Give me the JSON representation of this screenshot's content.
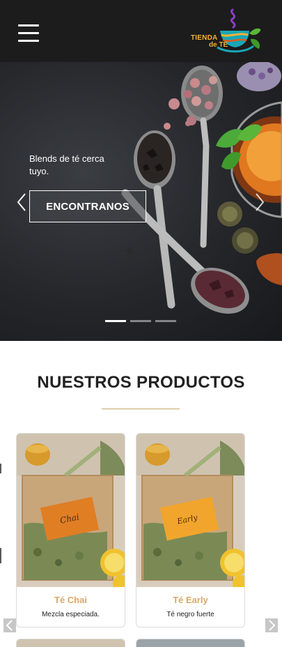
{
  "header": {
    "menu_icon": "hamburger-icon",
    "logo": {
      "line1": "TIENDA",
      "line2": "de TE"
    }
  },
  "hero": {
    "caption": "Blends de té cerca tuyo.",
    "button_label": "ENCONTRANOS",
    "prev_icon": "chevron-left-icon",
    "next_icon": "chevron-right-icon",
    "slides_count": 3,
    "active_slide": 1
  },
  "products": {
    "title": "NUESTROS PRODUCTOS",
    "items": [
      {
        "name": "Té Chai",
        "description": "Mezcla especiada."
      },
      {
        "name": "Té Early",
        "description": "Té negro fuerte"
      }
    ],
    "prev_icon": "chevron-left-icon",
    "next_icon": "chevron-right-icon"
  },
  "colors": {
    "header_bg": "#1c1c1c",
    "accent": "#d9a96b",
    "logo_gold": "#f3b233",
    "logo_teal": "#1aa6b7",
    "logo_green": "#5bb53a"
  }
}
